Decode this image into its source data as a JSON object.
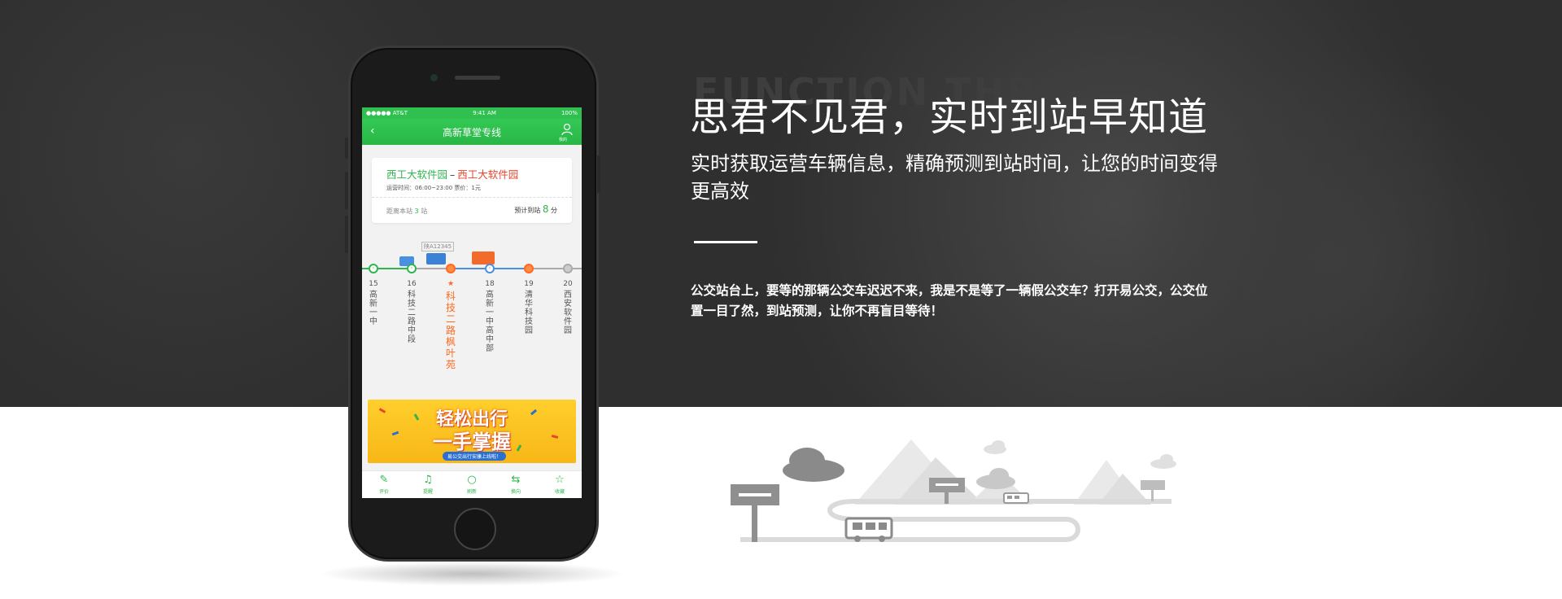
{
  "hero": {
    "ghost_text": "FUNCTION THR",
    "headline": "思君不见君，实时到站早知道",
    "subline": "实时获取运营车辆信息，精确预测到站时间，让您的时间变得更高效",
    "body": "公交站台上，要等的那辆公交车迟迟不来，我是不是等了一辆假公交车？打开易公交，公交位置一目了然，到站预测，让你不再盲目等待！"
  },
  "phone_app": {
    "status": {
      "carrier": "●●●●● AT&T",
      "time": "9:41 AM",
      "battery": "100%"
    },
    "nav": {
      "title": "高新草堂专线",
      "back_icon": "chevron-left-icon",
      "user_label": "我的"
    },
    "route": {
      "from": "西工大软件园",
      "dash": "–",
      "to": "西工大软件园",
      "hours": "运营时间：06:00~23:00  票价：1元",
      "distance_prefix": "距离本站",
      "distance_value": "3",
      "distance_suffix": "站",
      "eta_prefix": "预计到站",
      "eta_value": "8",
      "eta_suffix": "分"
    },
    "bus_plate": "陕A12345",
    "stops": [
      {
        "num": "15",
        "name": "高新一中"
      },
      {
        "num": "16",
        "name": "科技二路中段"
      },
      {
        "num": "★",
        "name": "科技二路枫叶苑"
      },
      {
        "num": "18",
        "name": "高新一中高中部"
      },
      {
        "num": "19",
        "name": "清华科技园"
      },
      {
        "num": "20",
        "name": "西安软件园"
      }
    ],
    "banner": {
      "line1": "轻松出行",
      "line2": "一手掌握",
      "line3": "易公交出行安康上线啦！"
    },
    "tabs": [
      {
        "icon": "edit-icon",
        "label": "评价"
      },
      {
        "icon": "bell-icon",
        "label": "提醒"
      },
      {
        "icon": "refresh-icon",
        "label": "刷新"
      },
      {
        "icon": "transfer-icon",
        "label": "换向"
      },
      {
        "icon": "star-icon",
        "label": "收藏"
      }
    ]
  },
  "colors": {
    "hero_bg": "#2f2f2f",
    "app_green": "#2fb54d",
    "highlight_orange": "#ff6a1f",
    "route_red": "#e8452d"
  }
}
